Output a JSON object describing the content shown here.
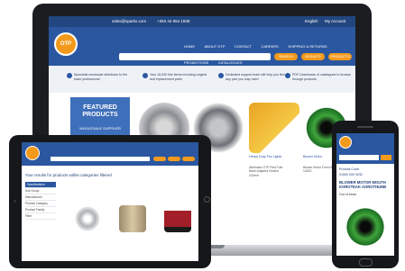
{
  "laptop": {
    "site": {
      "topbar": {
        "email": "sales@sparkx.com",
        "phone": "+353 44 954 1938",
        "lang": "English",
        "account": "My Account"
      },
      "logo": "OTP",
      "nav": [
        "HOME",
        "ABOUT OTP",
        "CONTACT",
        "CAREERS",
        "SHIPPING & RETURNS",
        "PROMOTIONS",
        "CATALOGUES"
      ],
      "search": {
        "placeholder": ""
      },
      "buttons": [
        "SEARCH",
        "RESULTS",
        "PRODUCTS"
      ],
      "features": [
        "Specialist wholesale distributor to the trade professional",
        "Your 16,000 line items including original and replacement parts",
        "Dedicated support team will help you find any part you may need",
        "PDF Downloads of catalogues to browse through products"
      ],
      "featured": {
        "title": "FEATURED PRODUCTS",
        "subtitle": "WHOLESALE SUPPLIER",
        "line": "ALL MAKE AND MODELS OF TRACTOR"
      },
      "product_labels": [
        "Heavy Duty Fan Lights",
        "Blower Motor"
      ],
      "product_texts": [
        "Alternator OTP Red Fuel Bank Adapted Hosted 110mm",
        "Blower Motor Fnmn Boron 14002"
      ]
    }
  },
  "tablet": {
    "title": "Your results for products within categories filtered",
    "sidebar": [
      "Specifications",
      "Sub Group",
      "Manufacturer",
      "Product Category",
      "Product Family",
      "Filter"
    ]
  },
  "phone": {
    "line1": "Product Code",
    "line2": "01500 000 9232",
    "title": "BLOWER MOTOR MOUTH KOROTEAK AOROTHUNB",
    "price": "Out of stock"
  }
}
